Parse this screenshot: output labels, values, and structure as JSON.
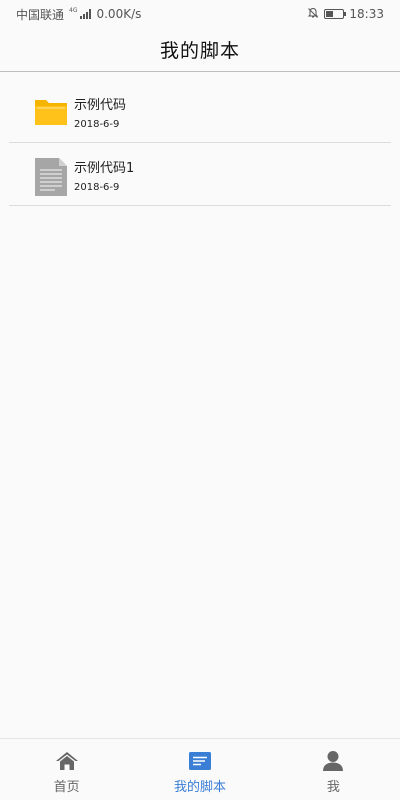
{
  "status_bar": {
    "carrier": "中国联通",
    "network_type": "4G",
    "speed": "0.00K/s",
    "time": "18:33",
    "battery_level": 0.4
  },
  "header": {
    "title": "我的脚本"
  },
  "scripts": [
    {
      "name": "示例代码",
      "date": "2018-6-9",
      "kind": "folder",
      "icon": "folder-icon",
      "color": "#f5b400"
    },
    {
      "name": "示例代码1",
      "date": "2018-6-9",
      "kind": "file",
      "icon": "document-icon",
      "color": "#a6a6a6"
    }
  ],
  "bottom_nav": {
    "active_color": "#3a7fd5",
    "inactive_color": "#666666",
    "tabs": [
      {
        "label": "首页",
        "icon": "home-icon",
        "active": false
      },
      {
        "label": "我的脚本",
        "icon": "script-list-icon",
        "active": true
      },
      {
        "label": "我",
        "icon": "person-icon",
        "active": false
      }
    ]
  }
}
